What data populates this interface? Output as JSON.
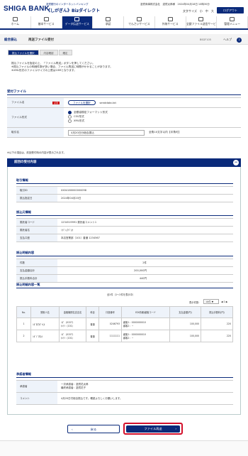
{
  "header": {
    "bank_name": "SHIGA BANK",
    "service_sub": "滋賀銀行のインターネットバンキング",
    "service_name": "《しがぎん》Bizダイレクト",
    "user_info": "滋賀商事株式会社　滋賀太郎様　2024年04月18日 10時30分",
    "text_size_label": "文字サイズ　小　中　大",
    "logout_label": "ログアウト"
  },
  "nav": [
    {
      "label": "ホーム",
      "icon": "home-icon"
    },
    {
      "label": "基本サービス",
      "icon": "basic-service-icon"
    },
    {
      "label": "データ伝送サービス",
      "icon": "data-transfer-icon",
      "active": true
    },
    {
      "label": "承認",
      "icon": "approval-icon"
    },
    {
      "label": "でんさいサービス",
      "icon": "densai-icon"
    },
    {
      "label": "外為サービス",
      "icon": "forex-icon"
    },
    {
      "label": "全銀ファイル送信サービス",
      "icon": "zengin-file-icon"
    },
    {
      "label": "管理メニュー",
      "icon": "admin-menu-icon"
    }
  ],
  "breadcrumb": {
    "group": "総合振込",
    "page_title": "再送ファイル受付",
    "screen_code": "BSGF105",
    "help_label": "ヘルプ"
  },
  "steps": [
    "振込ファイルを選択",
    "内容確認",
    "確定"
  ],
  "notes": [
    "振込ファイルを指定の上、「ファイル再送」ボタンを押してください。",
    "※振込ファイルの明細件数が多い場合、ファイル再送に時間がかかることがあります。",
    "※XML形式のファイルサイズの上限は10Mとなります。"
  ],
  "upload": {
    "title": "受付ファイル",
    "file_name_label": "ファイル名",
    "required_badge": "必須",
    "select_file_button": "ファイルを選択",
    "file_name_value": "senddata.txt",
    "format_label": "ファイル形式",
    "formats": [
      "全銀協規定フォーマット形式",
      "CSV形式",
      "XML形式"
    ],
    "memo_label": "取引名",
    "memo_value": "4月20日分総合振込",
    "memo_hint": "全角10文字以内【半角可】",
    "auto_note": "※以下の項目は、前回受付時の内容が表示されます。"
  },
  "previous": {
    "accordion_title": "前回の受付内容",
    "transaction_info_title": "取引情報",
    "transaction": [
      {
        "label": "取引ID",
        "value": "XX04180000000098"
      },
      {
        "label": "振込指定日",
        "value": "2024年04月20日"
      }
    ],
    "payer_title": "振込元情報",
    "payer": [
      {
        "label": "委託者コード",
        "value": "1234519991 委託者コメント1"
      },
      {
        "label": "委託者名",
        "value": "ｼｶﾞｼｮｳｼﾞ(ｶ"
      },
      {
        "label": "支払口座",
        "value": "本店営業部（101）普通 1234567"
      }
    ],
    "summary_title": "振込明細内容",
    "summary": [
      {
        "label": "件数",
        "value": "2件"
      },
      {
        "label": "支払金額合計",
        "value": "200,000円"
      },
      {
        "label": "振込手数料合計",
        "value": "440円"
      }
    ],
    "detail_title": "振込明細内容一覧",
    "pager_text": "全2件（1〜2件を表示中）",
    "per_page_label": "表示件数：",
    "per_page_value": "10件",
    "per_page_suffix": "▼",
    "pages": "◀ 1 ▶",
    "columns": [
      "No.",
      "受取人名",
      "金融機関名支店名",
      "科目",
      "口座番号",
      "EDI情報/顧客コード",
      "支払金額(円)",
      "振込手数料(円)"
    ],
    "rows": [
      {
        "no": "1",
        "name": "ｼｶﾞﾀﾛｳｶﾞｲ(ｶ",
        "bank": "ｼｶﾞ（0157）",
        "branch": "ﾎﾝﾃﾝ（101）",
        "type": "普通",
        "account": "0246793",
        "edi1": "顧客1：0000000010",
        "edi2": "顧客2：−",
        "amount": "100,000",
        "fee": "220"
      },
      {
        "no": "2",
        "name": "ｼｶﾞｼﾞﾛｳ(ｶ",
        "bank": "ｼｶﾞ（0157）",
        "branch": "ﾎﾝﾃﾝ（101）",
        "type": "普通",
        "account": "1111111",
        "edi1": "顧客1：0000000010",
        "edi2": "顧客2：−",
        "amount": "100,000",
        "fee": "220"
      }
    ],
    "approver_title": "承認者情報",
    "approver_label": "承認者",
    "approver_values": [
      "一次承認者：滋賀花太郎",
      "最終承認者：滋賀花子"
    ],
    "comment_label": "コメント",
    "comment_value": "4月20日付総合振込です。確認よろしくお願いします。"
  },
  "footer": {
    "back_button": "戻る",
    "resend_button": "ファイル再送"
  },
  "colors": {
    "brand": "#0a2a7a",
    "highlight": "#d3102b"
  }
}
